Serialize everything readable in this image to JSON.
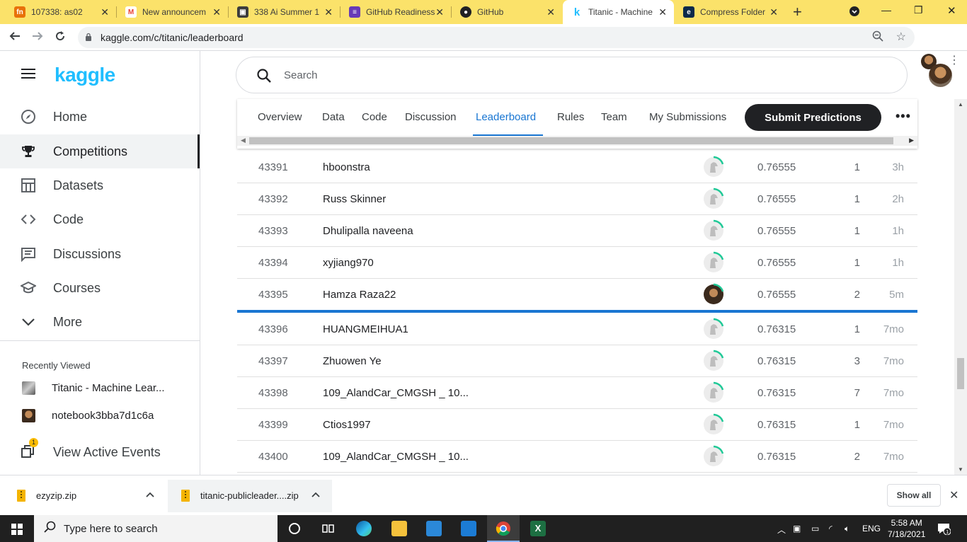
{
  "browser": {
    "tabs": [
      {
        "title": "107338: as02",
        "icon": "fm-icon",
        "color": "#e8710a"
      },
      {
        "title": "New announcem",
        "icon": "gmail-icon",
        "color": "#ea4335"
      },
      {
        "title": "338 Ai Summer 1",
        "icon": "classroom-icon",
        "color": "#202124"
      },
      {
        "title": "GitHub Readiness",
        "icon": "forms-icon",
        "color": "#673ab7"
      },
      {
        "title": "GitHub",
        "icon": "github-icon",
        "color": "#202124"
      },
      {
        "title": "Titanic - Machine",
        "icon": "kaggle-icon",
        "color": "#20beff"
      },
      {
        "title": "Compress Folder",
        "icon": "ezyzip-icon",
        "color": "#0b2a4a"
      }
    ],
    "url": "kaggle.com/c/titanic/leaderboard"
  },
  "sidebar": {
    "logo": "kaggle",
    "items": [
      {
        "label": "Home",
        "icon": "compass-icon"
      },
      {
        "label": "Competitions",
        "icon": "trophy-icon"
      },
      {
        "label": "Datasets",
        "icon": "table-icon"
      },
      {
        "label": "Code",
        "icon": "code-icon"
      },
      {
        "label": "Discussions",
        "icon": "discussion-icon"
      },
      {
        "label": "Courses",
        "icon": "graduation-cap-icon"
      },
      {
        "label": "More",
        "icon": "chevron-down-icon"
      }
    ],
    "recently_viewed_title": "Recently Viewed",
    "recently_viewed": [
      {
        "label": "Titanic - Machine Lear..."
      },
      {
        "label": "notebook3bba7d1c6a"
      }
    ],
    "active_events": "View Active Events",
    "active_events_badge": "1"
  },
  "search": {
    "placeholder": "Search"
  },
  "competition_tabs": {
    "items": [
      "Overview",
      "Data",
      "Code",
      "Discussion",
      "Leaderboard",
      "Rules",
      "Team",
      "My Submissions"
    ],
    "active": "Leaderboard",
    "submit": "Submit Predictions"
  },
  "leaderboard": {
    "rows": [
      {
        "rank": "43391",
        "team": "hboonstra",
        "score": "0.76555",
        "entries": "1",
        "last": "3h"
      },
      {
        "rank": "43392",
        "team": "Russ Skinner",
        "score": "0.76555",
        "entries": "1",
        "last": "2h"
      },
      {
        "rank": "43393",
        "team": "Dhulipalla naveena",
        "score": "0.76555",
        "entries": "1",
        "last": "1h"
      },
      {
        "rank": "43394",
        "team": "xyjiang970",
        "score": "0.76555",
        "entries": "1",
        "last": "1h"
      },
      {
        "rank": "43395",
        "team": "Hamza Raza22",
        "score": "0.76555",
        "entries": "2",
        "last": "5m"
      },
      {
        "rank": "43396",
        "team": "HUANGMEIHUA1",
        "score": "0.76315",
        "entries": "1",
        "last": "7mo"
      },
      {
        "rank": "43397",
        "team": "Zhuowen Ye",
        "score": "0.76315",
        "entries": "3",
        "last": "7mo"
      },
      {
        "rank": "43398",
        "team": "109_AlandCar_CMGSH _ 10...",
        "score": "0.76315",
        "entries": "7",
        "last": "7mo"
      },
      {
        "rank": "43399",
        "team": "Ctios1997",
        "score": "0.76315",
        "entries": "1",
        "last": "7mo"
      },
      {
        "rank": "43400",
        "team": "109_AlandCar_CMGSH _ 10...",
        "score": "0.76315",
        "entries": "2",
        "last": "7mo"
      }
    ]
  },
  "downloads": {
    "files": [
      "ezyzip.zip",
      "titanic-publicleader....zip"
    ],
    "show_all": "Show all"
  },
  "taskbar": {
    "search_placeholder": "Type here to search",
    "language": "ENG",
    "time": "5:58 AM",
    "date": "7/18/2021",
    "notification_count": "1"
  },
  "colors": {
    "accent": "#1976d2",
    "kaggle": "#20beff",
    "tab_strip": "#fbe26a"
  }
}
